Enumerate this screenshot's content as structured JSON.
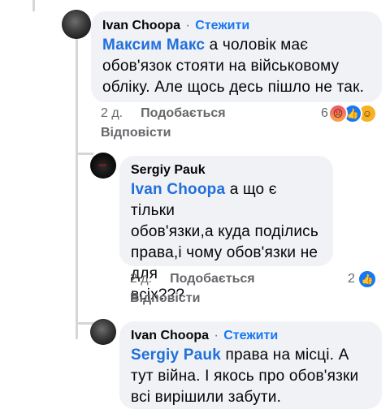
{
  "comments": [
    {
      "author": "Ivan Choopa",
      "separator": "·",
      "follow_label": "Стежити",
      "mention": "Максим Макс",
      "lines": [
        " а чоловік має",
        "обов'язок стояти на військовому",
        "обліку. Але щось десь пішло не так."
      ],
      "time": "2 д.",
      "like_label": "Подобається",
      "reply_label": "Відповісти",
      "reaction_count": "6",
      "reactions": [
        "angry-icon",
        "like-icon",
        "haha-icon"
      ]
    },
    {
      "author": "Sergiy  Pauk",
      "mention": "Ivan Choopa",
      "lines": [
        " а що є тільки",
        "обов'язки,а куда поділись",
        "права,і чому обов'язки не для",
        "всіх???"
      ],
      "time": "2 д.",
      "like_label": "Подобається",
      "reply_label": "Відповісти",
      "reaction_count": "2",
      "reactions": [
        "like-icon"
      ]
    },
    {
      "author": "Ivan Choopa",
      "separator": "·",
      "follow_label": "Стежити",
      "mention": "Sergiy  Pauk",
      "lines": [
        " права на місці. А",
        "тут війна. І якось про обов'язки",
        "всі вирішили забути."
      ]
    }
  ],
  "colors": {
    "bubble": "#f0f2f5",
    "mention": "#216fdb",
    "follow": "#1877f2",
    "muted": "#65676b"
  }
}
